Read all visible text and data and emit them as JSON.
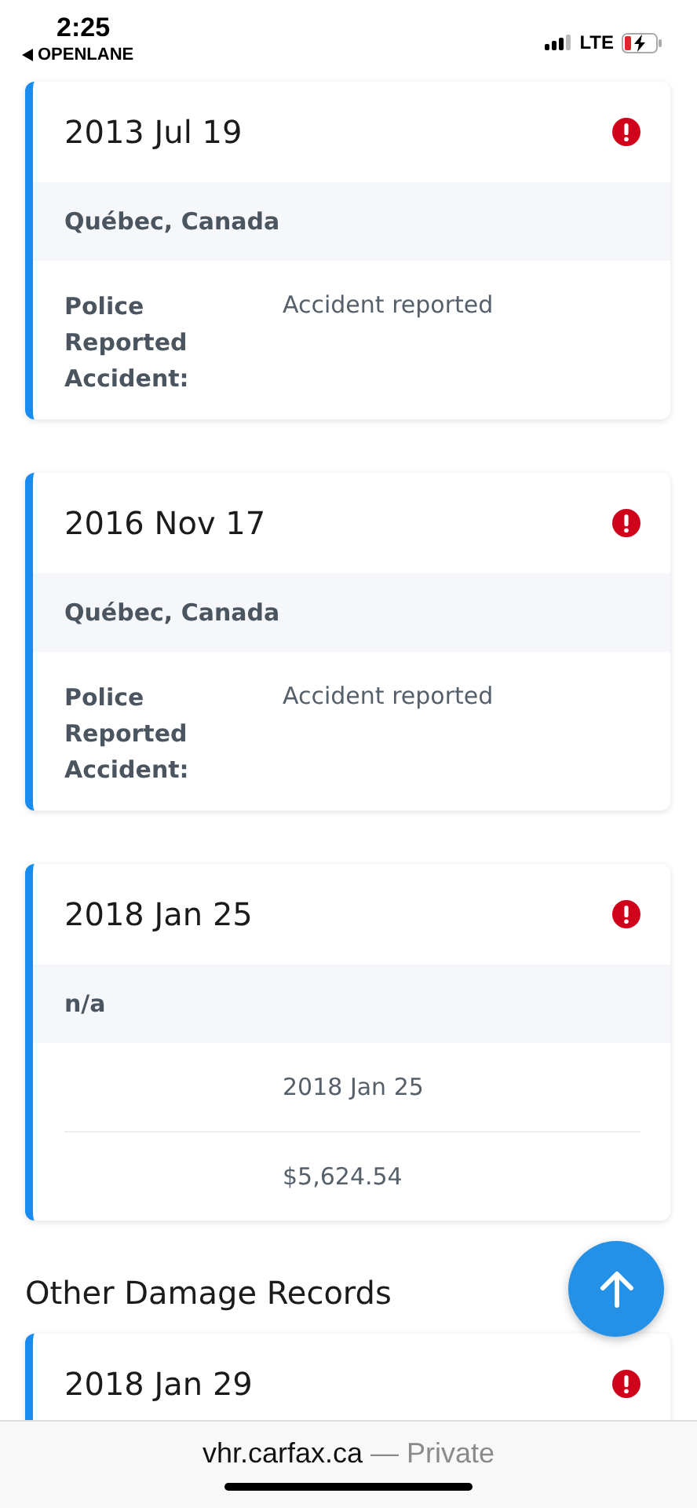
{
  "status_bar": {
    "time": "2:25",
    "back_label": "OPENLANE",
    "network": "LTE"
  },
  "cards": [
    {
      "date": "2013 Jul 19",
      "alert": true,
      "location": "Québec, Canada",
      "details": [
        {
          "label": "Police Reported Accident:",
          "value": "Accident reported"
        }
      ]
    },
    {
      "date": "2016 Nov 17",
      "alert": true,
      "location": "Québec, Canada",
      "details": [
        {
          "label": "Police Reported Accident:",
          "value": "Accident reported"
        }
      ]
    },
    {
      "date": "2018 Jan 25",
      "alert": true,
      "location": "n/a",
      "details": [
        {
          "value": "2018 Jan 25"
        },
        {
          "value": "$5,624.54"
        }
      ]
    }
  ],
  "section_title": "Other Damage Records",
  "other_cards": [
    {
      "date": "2018 Jan 29",
      "alert": true
    }
  ],
  "address_bar": {
    "domain": "vhr.carfax.ca",
    "mode": "— Private"
  }
}
